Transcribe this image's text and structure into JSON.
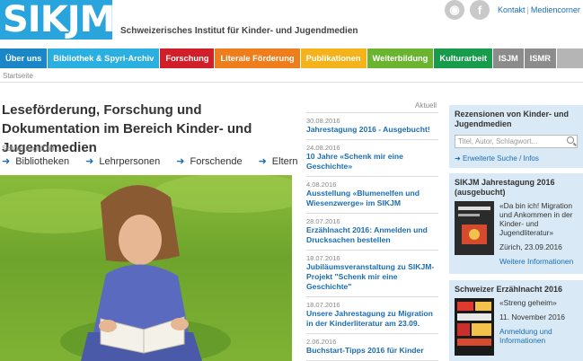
{
  "header": {
    "logo": "SIKJM",
    "institute": "Schweizerisches Institut für Kinder- und Jugendmedien",
    "links": [
      "Kontakt",
      "Mediencorner"
    ]
  },
  "nav": [
    {
      "label": "Über uns",
      "color": "#1a86c8"
    },
    {
      "label": "Bibliothek & Spyri-Archiv",
      "color": "#2ab0e0"
    },
    {
      "label": "Forschung",
      "color": "#d11f2a"
    },
    {
      "label": "Literale Förderung",
      "color": "#f07d1c"
    },
    {
      "label": "Publikationen",
      "color": "#f4b21b"
    },
    {
      "label": "Weiterbildung",
      "color": "#6bb42f"
    },
    {
      "label": "Kulturarbeit",
      "color": "#169c4b"
    },
    {
      "label": "ISJM",
      "color": "#8c8c8c"
    },
    {
      "label": "ISMR",
      "color": "#8c8c8c"
    }
  ],
  "breadcrumb": "Startseite",
  "headline": "Leseförderung, Forschung und Dokumentation im Bereich Kinder- und Jugendmedien",
  "quick": {
    "label": "Schnellzugriff für...",
    "links": [
      "Bibliotheken",
      "Lehrpersonen",
      "Forschende",
      "Eltern"
    ]
  },
  "news": {
    "label": "Aktuell",
    "items": [
      {
        "date": "30.08.2016",
        "title": "Jahrestagung 2016 - Ausgebucht!"
      },
      {
        "date": "24.08.2016",
        "title": "10 Jahre «Schenk mir eine Geschichte»"
      },
      {
        "date": "4.08.2016",
        "title": "Ausstellung «Blumenelfen und Wiesenzwerge» im SIKJM"
      },
      {
        "date": "28.07.2016",
        "title": "Erzählnacht 2016: Anmelden und Drucksachen bestellen"
      },
      {
        "date": "18.07.2016",
        "title": "Jubiläumsveranstaltung zu SIKJM-Projekt \"Schenk mir eine Geschichte\""
      },
      {
        "date": "18.07.2016",
        "title": "Unsere Jahrestagung zu Migration in der Kinderliteratur am 23.09."
      },
      {
        "date": "2.06.2016",
        "title": "Buchstart-Tipps 2016 für Kinder"
      }
    ]
  },
  "sidebar": {
    "reviews": {
      "title": "Rezensionen von Kinder- und Jugendmedien",
      "placeholder": "Titel, Autor, Schlagwort...",
      "advanced": "Erweiterte Suche / Infos"
    },
    "conference": {
      "title": "SIKJM Jahrestagung 2016 (ausgebucht)",
      "text": "«Da bin ich! Migration und Ankommen in der Kinder- und Jugendliteratur»",
      "date": "Zürich, 23.09.2016",
      "more": "Weitere Informationen"
    },
    "storynight": {
      "title": "Schweizer Erzählnacht 2016",
      "text": "«Streng geheim»",
      "date": "11. November 2016",
      "more": "Anmeldung und Informationen"
    }
  }
}
